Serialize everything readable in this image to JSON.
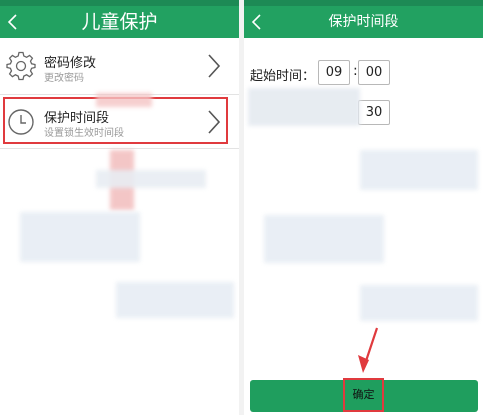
{
  "left_screen": {
    "title": "儿童保护",
    "items": [
      {
        "title": "密码修改",
        "subtitle": "更改密码",
        "icon": "gear-icon"
      },
      {
        "title": "保护时间段",
        "subtitle": "设置锁生效时间段",
        "icon": "clock-icon"
      }
    ]
  },
  "right_screen": {
    "title": "保护时间段",
    "start": {
      "label": "起始时间：",
      "hour": "09",
      "minute": "00"
    },
    "end": {
      "minute": "30"
    },
    "confirm_label": "确定"
  },
  "colors": {
    "title_bar": "#22a161",
    "status_bar": "#1d8a55",
    "confirm_button": "#1f9e5e",
    "highlight": "#e03a3e"
  }
}
